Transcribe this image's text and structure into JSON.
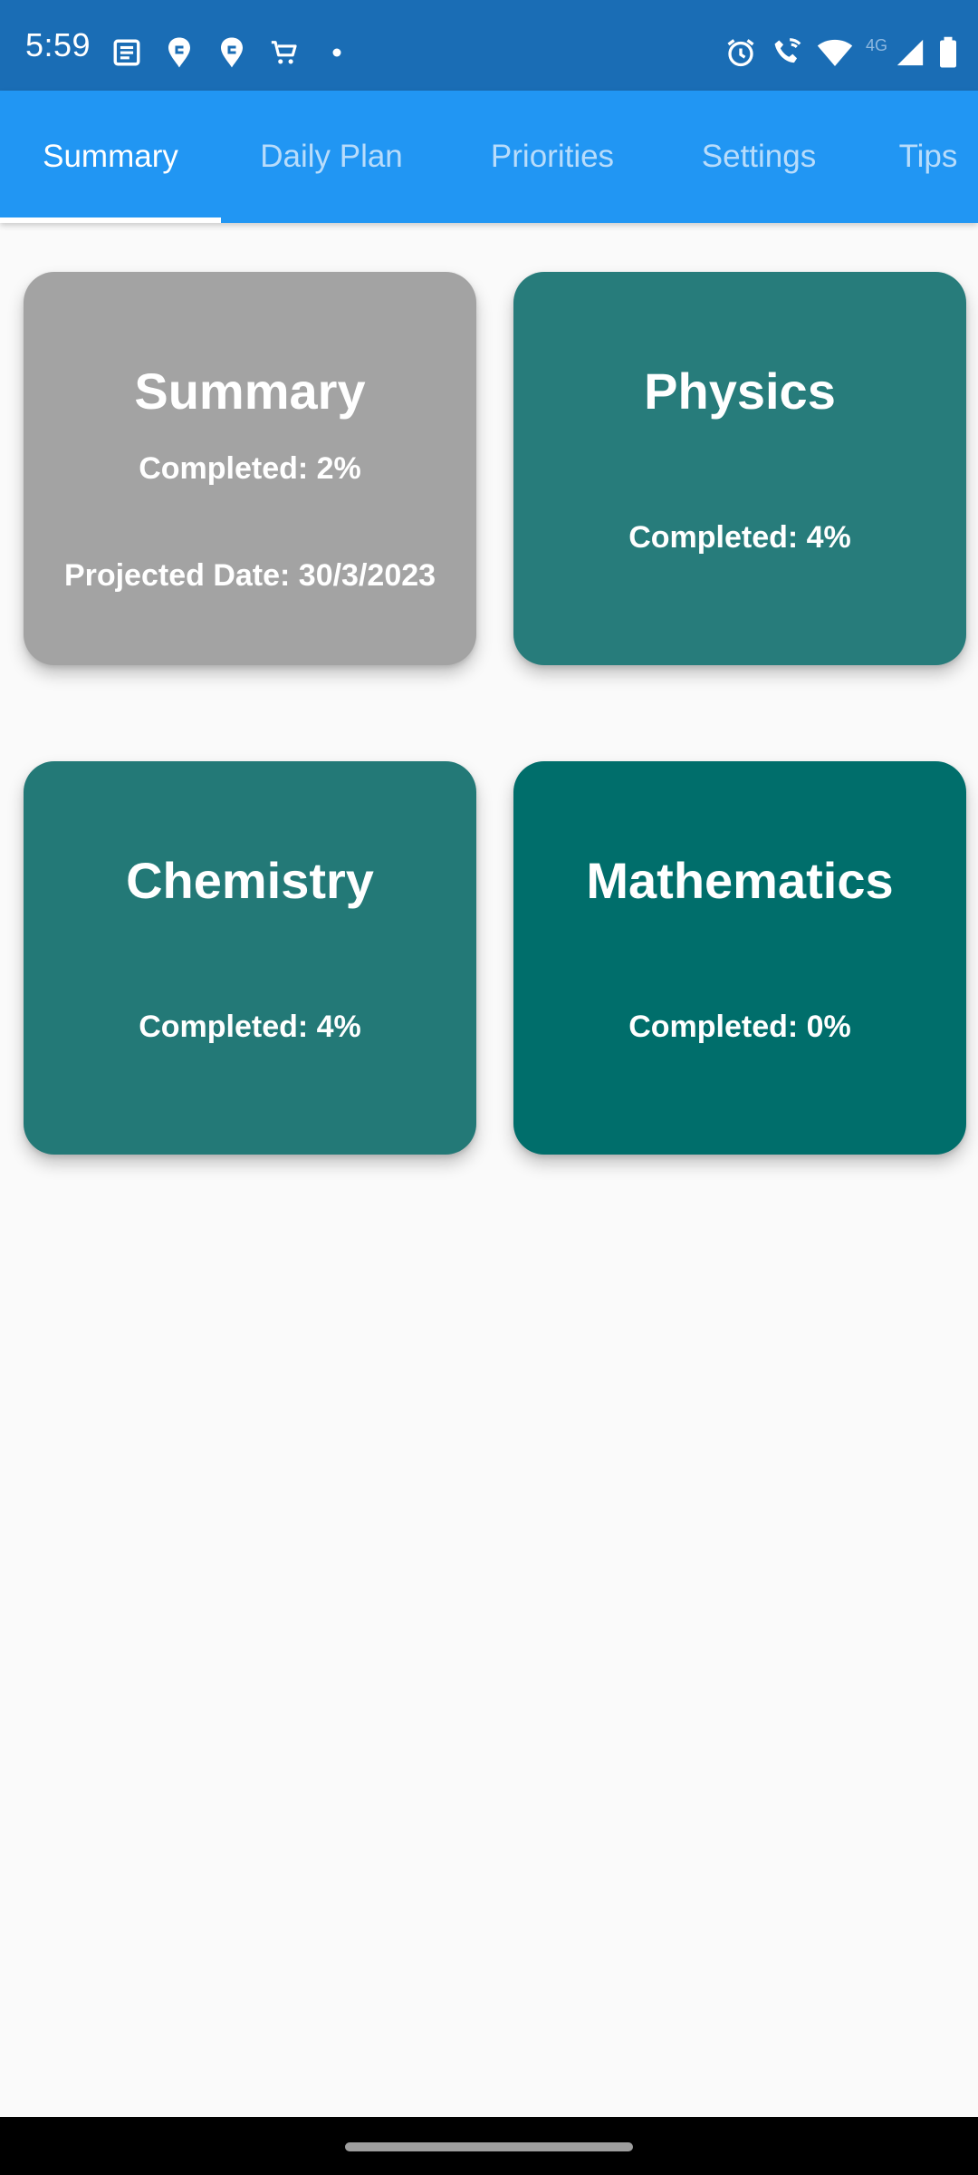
{
  "status_bar": {
    "time": "5:59",
    "network_label": "4G",
    "left_icons": [
      "news-icon",
      "swiggy-icon",
      "swiggy-icon",
      "cart-icon",
      "dot-icon"
    ],
    "right_icons": [
      "alarm-icon",
      "wifi-call-icon",
      "wifi-icon",
      "signal-icon",
      "battery-icon"
    ]
  },
  "tabs": [
    {
      "label": "Summary",
      "active": true
    },
    {
      "label": "Daily Plan",
      "active": false
    },
    {
      "label": "Priorities",
      "active": false
    },
    {
      "label": "Settings",
      "active": false
    },
    {
      "label": "Tips",
      "active": false
    }
  ],
  "cards": {
    "summary": {
      "title": "Summary",
      "completed": "Completed: 2%",
      "projected": "Projected Date: 30/3/2023",
      "color": "#a3a3a3"
    },
    "physics": {
      "title": "Physics",
      "completed": "Completed: 4%",
      "color": "#277c7b"
    },
    "chemistry": {
      "title": "Chemistry",
      "completed": "Completed: 4%",
      "color": "#237977"
    },
    "mathematics": {
      "title": "Mathematics",
      "completed": "Completed: 0%",
      "color": "#006e6b"
    }
  },
  "colors": {
    "status_bar": "#1a6db5",
    "app_bar": "#2196f3",
    "background": "#fafafa"
  }
}
